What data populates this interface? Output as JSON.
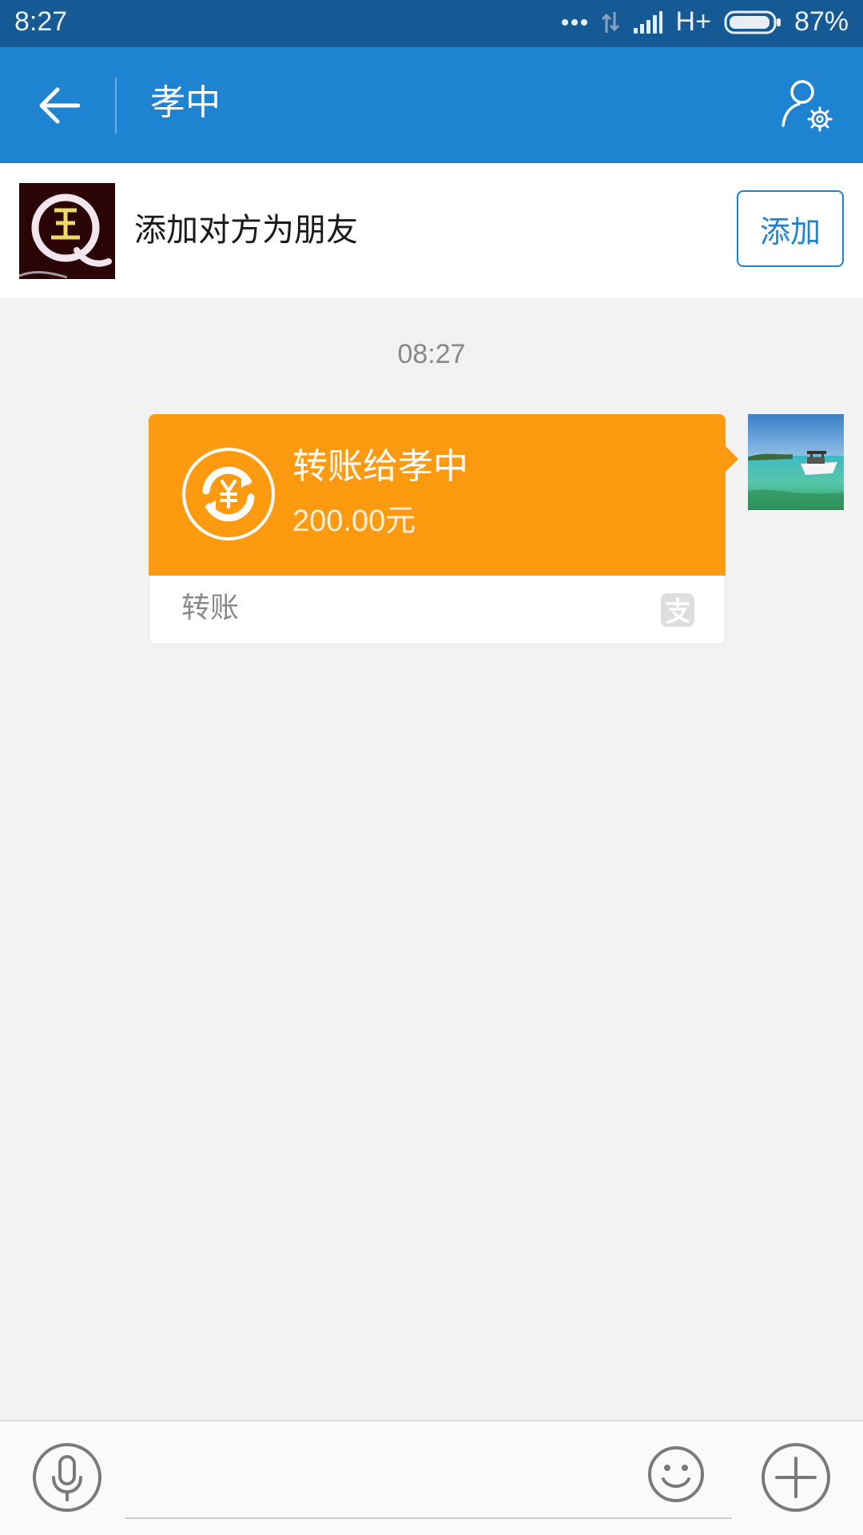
{
  "status_bar": {
    "time": "8:27",
    "network": "H+",
    "battery": "87%",
    "icons": [
      "more-dots-icon",
      "data-arrows-icon",
      "signal-icon",
      "battery-icon"
    ]
  },
  "header": {
    "title": "孝中",
    "back_icon": "back-arrow-icon",
    "settings_icon": "profile-settings-icon"
  },
  "add_friend_banner": {
    "text": "添加对方为朋友",
    "button_label": "添加"
  },
  "chat": {
    "timestamp": "08:27",
    "message": {
      "title": "转账给孝中",
      "amount": "200.00元",
      "type_label": "转账",
      "icon": "transfer-yuan-icon",
      "brand_icon": "alipay-icon"
    }
  },
  "input_bar": {
    "placeholder": "",
    "icons": [
      "microphone-icon",
      "emoji-icon",
      "plus-icon"
    ]
  },
  "colors": {
    "status_bar": "#155a94",
    "header": "#1e83d1",
    "transfer_card": "#fd9a10",
    "chat_background": "#f2f2f2"
  }
}
